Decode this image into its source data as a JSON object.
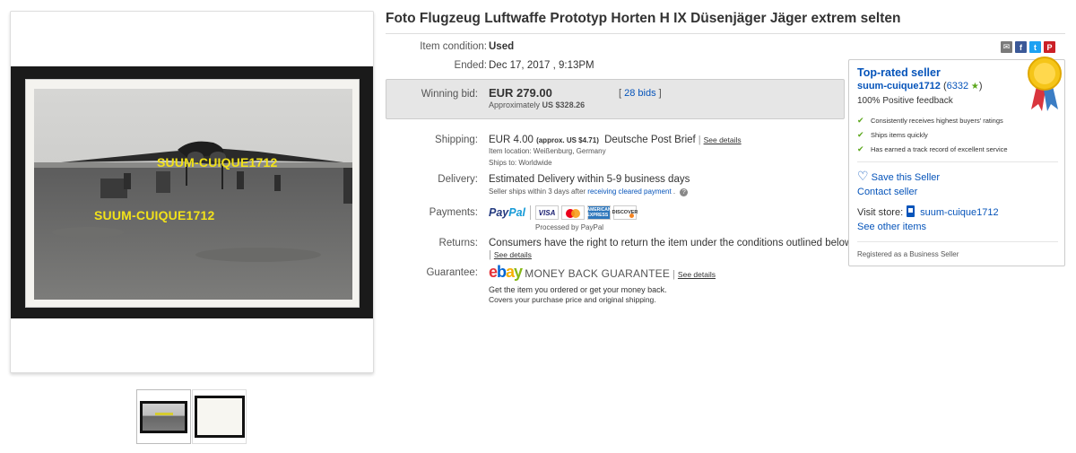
{
  "listing": {
    "title": "Foto Flugzeug Luftwaffe Prototyp Horten H IX Düsenjäger Jäger extrem selten",
    "watermark": "SUUM-CUIQUE1712"
  },
  "details": {
    "condition_label": "Item condition:",
    "condition_value": "Used",
    "ended_label": "Ended:",
    "ended_value": "Dec 17, 2017 , 9:13PM",
    "winning_label": "Winning bid:",
    "winning_amount": "EUR 279.00",
    "approx_prefix": "Approximately",
    "approx_value": "US $328.26",
    "bids_open": "[",
    "bids_link": "28 bids",
    "bids_close": "]",
    "shipping_label": "Shipping:",
    "shipping_amount": "EUR 4.00",
    "shipping_approx": "(approx. US $4.71)",
    "shipping_service": "Deutsche Post Brief",
    "see_details": "See details",
    "item_location": "Item location:   Weißenburg, Germany",
    "ships_to": "Ships to:   Worldwide",
    "delivery_label": "Delivery:",
    "delivery_value": "Estimated Delivery within 5-9 business days",
    "delivery_note": "Seller ships within 3 days after",
    "delivery_link": "receiving cleared payment",
    "payments_label": "Payments:",
    "paypal_1": "Pay",
    "paypal_2": "Pal",
    "visa": "VISA",
    "amex": "AMERICAN EXPRESS",
    "discover": "DISCOVER",
    "processed": "Processed by PayPal",
    "returns_label": "Returns:",
    "returns_value": "Consumers have the right to return the item under the conditions outlined below",
    "guarantee_label": "Guarantee:",
    "ebay_e": "e",
    "ebay_b": "b",
    "ebay_a": "a",
    "ebay_y": "y",
    "mbg": "MONEY BACK GUARANTEE",
    "guarantee_line1": "Get the item you ordered or get your money back.",
    "guarantee_line2": "Covers your purchase price and original shipping."
  },
  "share": {
    "email_glyph": "✉",
    "facebook": "f",
    "twitter": "t",
    "pinterest": "P"
  },
  "seller": {
    "top_rated": "Top-rated seller",
    "username": "suum-cuique1712",
    "score_open": "(",
    "score": "6332",
    "score_close": ")",
    "feedback": "100% Positive feedback",
    "badges": [
      "Consistently receives highest buyers' ratings",
      "Ships items quickly",
      "Has earned a track record of excellent service"
    ],
    "save_seller": "Save this Seller",
    "contact_seller": "Contact seller",
    "visit_store_label": "Visit store:",
    "store_name": "suum-cuique1712",
    "other_items": "See other items",
    "registered": "Registered as a Business Seller"
  },
  "colors": {
    "link": "#0654ba",
    "star": "#5ba71b",
    "watermark": "#f2e21a"
  }
}
